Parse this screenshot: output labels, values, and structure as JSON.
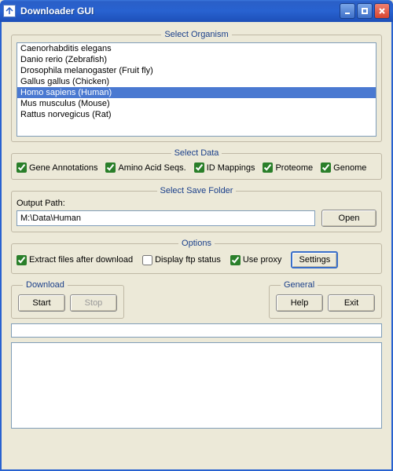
{
  "window": {
    "title": "Downloader GUI"
  },
  "organism": {
    "legend": "Select Organism",
    "items": [
      "Caenorhabditis elegans",
      "Danio rerio (Zebrafish)",
      "Drosophila melanogaster (Fruit fly)",
      "Gallus gallus (Chicken)",
      "Homo sapiens (Human)",
      "Mus musculus (Mouse)",
      "Rattus norvegicus (Rat)"
    ],
    "selected_index": 4
  },
  "data": {
    "legend": "Select Data",
    "checks": [
      {
        "label": "Gene Annotations",
        "checked": true
      },
      {
        "label": "Amino Acid Seqs.",
        "checked": true
      },
      {
        "label": "ID Mappings",
        "checked": true
      },
      {
        "label": "Proteome",
        "checked": true
      },
      {
        "label": "Genome",
        "checked": true
      }
    ]
  },
  "save": {
    "legend": "Select Save Folder",
    "path_label": "Output Path:",
    "path_value": "M:\\Data\\Human",
    "open_label": "Open"
  },
  "options": {
    "legend": "Options",
    "extract": {
      "label": "Extract files after download",
      "checked": true
    },
    "ftp": {
      "label": "Display ftp status",
      "checked": false
    },
    "proxy": {
      "label": "Use proxy",
      "checked": true
    },
    "settings_label": "Settings"
  },
  "download": {
    "legend": "Download",
    "start_label": "Start",
    "stop_label": "Stop"
  },
  "general": {
    "legend": "General",
    "help_label": "Help",
    "exit_label": "Exit"
  }
}
